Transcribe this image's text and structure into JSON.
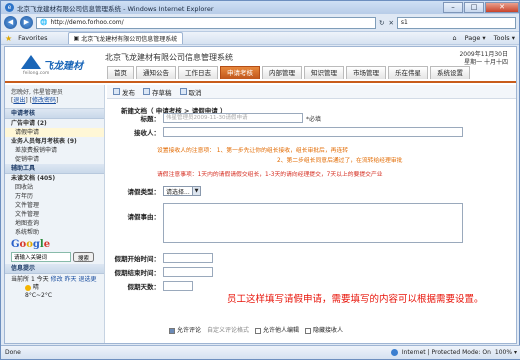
{
  "window": {
    "title": "北京飞龙建材有限公司信息管理系统 - Windows Internet Explorer",
    "minimize": "–",
    "maximize": "□",
    "close": "✕"
  },
  "browser": {
    "url": "http://demo.forhoo.com/",
    "search_placeholder": "s1",
    "favorites_label": "Favorites",
    "tab_title": "北京飞龙建材有限公司信息管理系统",
    "page_menu": "Page ▾",
    "tools_menu": "Tools ▾"
  },
  "header": {
    "logo_brand": "飞龙建材",
    "logo_url": "feilong.com",
    "system_title": "北京飞龙建材有限公司信息管理系统",
    "date": "2009年11月30日",
    "weekday": "星期一 十月十四",
    "tabs": [
      {
        "label": "首页",
        "active": false
      },
      {
        "label": "通知公告",
        "active": false
      },
      {
        "label": "工作日志",
        "active": false
      },
      {
        "label": "申请考核",
        "active": true
      },
      {
        "label": "内部管理",
        "active": false
      },
      {
        "label": "知识管理",
        "active": false
      },
      {
        "label": "市场管理",
        "active": false
      },
      {
        "label": "乐在伟星",
        "active": false
      },
      {
        "label": "系统设置",
        "active": false
      }
    ]
  },
  "sidebar": {
    "greeting": "您晚好, 伟星管理员",
    "logout": "退出",
    "change_pwd": "修改密码",
    "section1": "申请考核",
    "items1": [
      {
        "label": "广告申请 (2)",
        "bold": true,
        "selected": false
      },
      {
        "label": "请假申请",
        "bold": false,
        "selected": true
      },
      {
        "label": "业务人员每月考核表 (9)",
        "bold": true,
        "selected": false
      },
      {
        "label": "差旅费报销申请",
        "bold": false,
        "selected": false
      },
      {
        "label": "促销申请",
        "bold": false,
        "selected": false
      }
    ],
    "section2": "辅助工具",
    "items2": [
      {
        "label": "未读文档 (405)",
        "bold": true
      },
      {
        "label": "回收站",
        "bold": false
      },
      {
        "label": "万年历",
        "bold": false
      },
      {
        "label": "文件管理",
        "bold": false
      },
      {
        "label": "文件管理",
        "bold": false
      },
      {
        "label": "地图查询",
        "bold": false
      },
      {
        "label": "系统帮助",
        "bold": false
      }
    ],
    "google_input": "请输入关键词",
    "google_button": "搜索",
    "section3": "信息提示",
    "weather_city": "当前所",
    "weather_day": "1 今天",
    "weather_links": [
      "修改",
      "昨天",
      "退选更"
    ],
    "weather_desc": "晴",
    "weather_temp": "8°C~2°C"
  },
  "toolbar": {
    "publish": "发布",
    "save_draft": "存草稿",
    "cancel": "取消"
  },
  "form": {
    "breadcrumb": "新建文档（ 申请考核 > 请假申请 ）",
    "title_label": "标题：",
    "title_placeholder": "伟星管理员2009-11-30请假申请",
    "title_required": "*必填",
    "receiver_label": "接收人：",
    "note1": "设置接收人的注意项：  1、第一步先让你的组长接收，组长审批后，再连转",
    "note2": "2、第二步组长同意后通过了，在流转给经理审批",
    "note3": "请假注意事项：1天内的请假请假交组长，1-3天的请向经理提交，7天以上的要提交产业",
    "type_label": "请假类型：",
    "type_value": "请选择...",
    "reason_label": "请假事由：",
    "start_label": "假期开始时间：",
    "end_label": "假期结束时间：",
    "days_label": "假期天数：",
    "overlay_text": "员工这样填写请假申请，需要填写的内容可以根据需要设置。",
    "check_comment": "允许评论",
    "check_comment_link": "自定义评论格式",
    "check_edit": "允许他人编辑",
    "check_hide": "隐藏接收人"
  },
  "status": {
    "left": "Done",
    "zone": "Internet | Protected Mode: On",
    "zoom": "100% ▾"
  }
}
